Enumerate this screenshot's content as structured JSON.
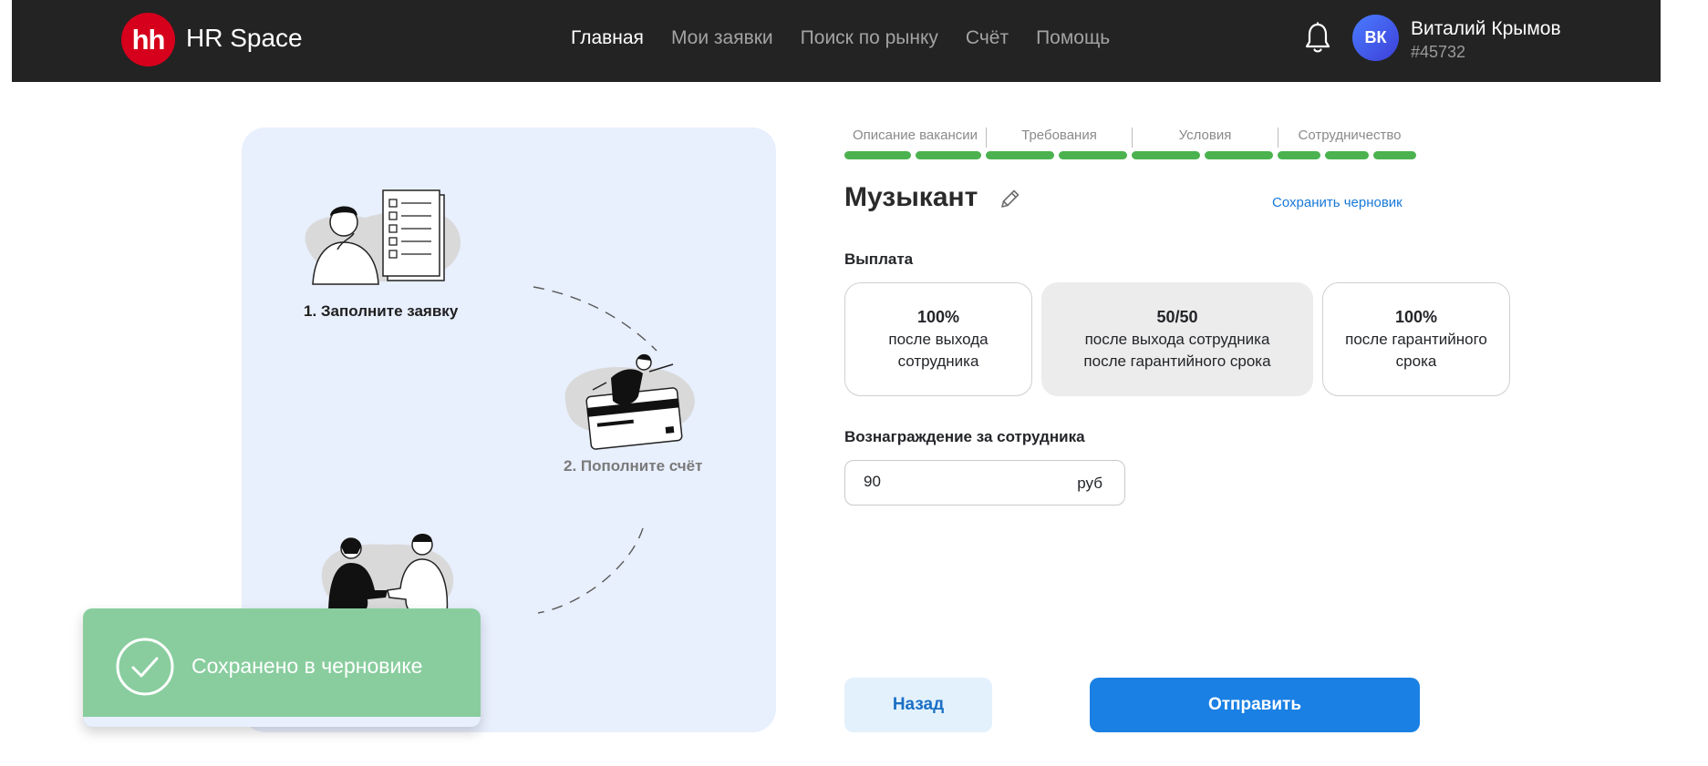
{
  "header": {
    "logo_mark": "hh",
    "logo_text": "HR Space",
    "nav": [
      {
        "label": "Главная",
        "active": true
      },
      {
        "label": "Мои заявки",
        "active": false
      },
      {
        "label": "Поиск по рынку",
        "active": false
      },
      {
        "label": "Счёт",
        "active": false
      },
      {
        "label": "Помощь",
        "active": false
      }
    ],
    "notification_icon": "bell-icon",
    "user": {
      "initials": "ВК",
      "name": "Виталий Крымов",
      "id": "#45732"
    }
  },
  "illustration": {
    "steps": [
      {
        "label": "1. Заполните заявку",
        "icon": "checklist-person-illustration"
      },
      {
        "label": "2. Пополните счёт",
        "icon": "card-person-illustration"
      },
      {
        "label": "",
        "icon": "handshake-illustration"
      }
    ]
  },
  "stepper": {
    "steps": [
      {
        "label": "Описание вакансии",
        "segments": 2
      },
      {
        "label": "Требования",
        "segments": 2
      },
      {
        "label": "Условия",
        "segments": 2
      },
      {
        "label": "Сотрудничество",
        "segments": 3
      }
    ],
    "completed_segments": 9,
    "total_segments": 9,
    "color": "#4bb24f"
  },
  "form": {
    "title": "Музыкант",
    "edit_icon": "pencil-icon",
    "save_draft": "Сохранить черновик",
    "payment_label": "Выплата",
    "payment_options": [
      {
        "percent": "100%",
        "desc": "после выхода\nсотрудника",
        "selected": false
      },
      {
        "percent": "50/50",
        "desc": "после выхода сотрудника\nпосле гарантийного срока",
        "selected": true
      },
      {
        "percent": "100%",
        "desc": "после гарантийного\nсрока",
        "selected": false
      }
    ],
    "reward_label": "Вознаграждение за сотрудника",
    "reward_value": "90",
    "reward_currency": "руб",
    "back_button": "Назад",
    "submit_button": "Отправить"
  },
  "toast": {
    "message": "Сохранено в черновике",
    "icon": "checkmark-circle-icon",
    "color": "#89cd9e"
  }
}
